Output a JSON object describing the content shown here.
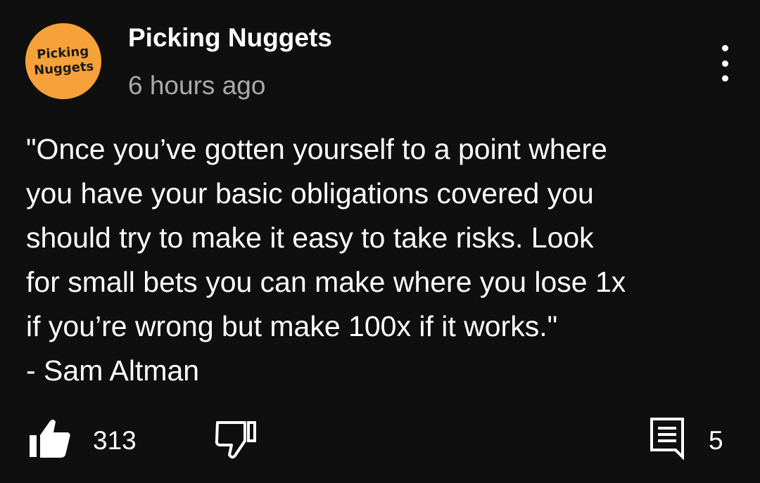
{
  "comment": {
    "avatar": {
      "line1": "Picking",
      "line2": "Nuggets",
      "color": "#f7a13a"
    },
    "author": "Picking Nuggets",
    "time": "6 hours ago",
    "menu_icon": "more-vert-icon",
    "text_lines": [
      "\"Once you’ve gotten yourself to a point where",
      "you have your basic obligations covered you",
      "should try to make it easy to take risks. Look",
      "for small bets you can make where you lose 1x",
      "if you’re wrong but make 100x if it works.\"",
      "- Sam Altman"
    ],
    "like_icon": "thumb-up-icon",
    "like_count": "313",
    "dislike_icon": "thumb-down-icon",
    "reply_icon": "comment-icon",
    "reply_count": "5"
  }
}
